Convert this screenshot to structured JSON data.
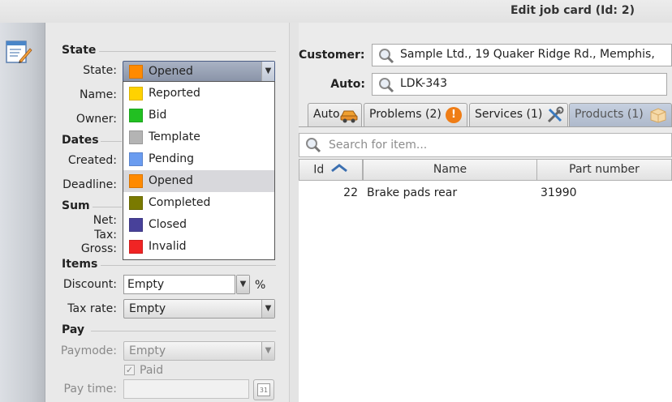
{
  "window": {
    "title": "Edit job card (Id: 2)"
  },
  "sections": {
    "state": "State",
    "dates": "Dates",
    "sum": "Sum",
    "items": "Items",
    "pay": "Pay"
  },
  "labels": {
    "state": "State:",
    "name": "Name:",
    "owner": "Owner:",
    "created": "Created:",
    "deadline": "Deadline:",
    "net": "Net:",
    "tax": "Tax:",
    "gross": "Gross:",
    "discount": "Discount:",
    "discount_unit": "%",
    "tax_rate": "Tax rate:",
    "paymode": "Paymode:",
    "paid": "Paid",
    "pay_time": "Pay time:"
  },
  "state_combo": {
    "value": "Opened",
    "color": "#ff8a00"
  },
  "state_options": [
    {
      "label": "Reported",
      "color": "#ffd200"
    },
    {
      "label": "Bid",
      "color": "#22c022"
    },
    {
      "label": "Template",
      "color": "#b4b4b4"
    },
    {
      "label": "Pending",
      "color": "#6a9cf0"
    },
    {
      "label": "Opened",
      "color": "#ff8a00",
      "selected": true
    },
    {
      "label": "Completed",
      "color": "#7a7a00"
    },
    {
      "label": "Closed",
      "color": "#48419a"
    },
    {
      "label": "Invalid",
      "color": "#f02424"
    }
  ],
  "discount": {
    "value": "Empty"
  },
  "tax_rate": {
    "value": "Empty"
  },
  "paymode": {
    "value": "Empty"
  },
  "paid_checked": true,
  "pay_time_button": "31",
  "customer": {
    "label": "Customer:",
    "value": "Sample Ltd., 19 Quaker Ridge Rd., Memphis,"
  },
  "auto": {
    "label": "Auto:",
    "value": "LDK-343"
  },
  "tabs": [
    {
      "label": "Auto",
      "icon": "car-icon"
    },
    {
      "label": "Problems (2)",
      "icon": "warning-icon"
    },
    {
      "label": "Services (1)",
      "icon": "tools-icon"
    },
    {
      "label": "Products (1)",
      "icon": "box-icon",
      "active": true
    }
  ],
  "item_search": {
    "placeholder": "Search for item..."
  },
  "table": {
    "columns": [
      "Id",
      "Name",
      "Part number"
    ],
    "sort_column": "Id",
    "rows": [
      {
        "id": "22",
        "name": "Brake pads rear",
        "part_number": "31990"
      }
    ]
  }
}
